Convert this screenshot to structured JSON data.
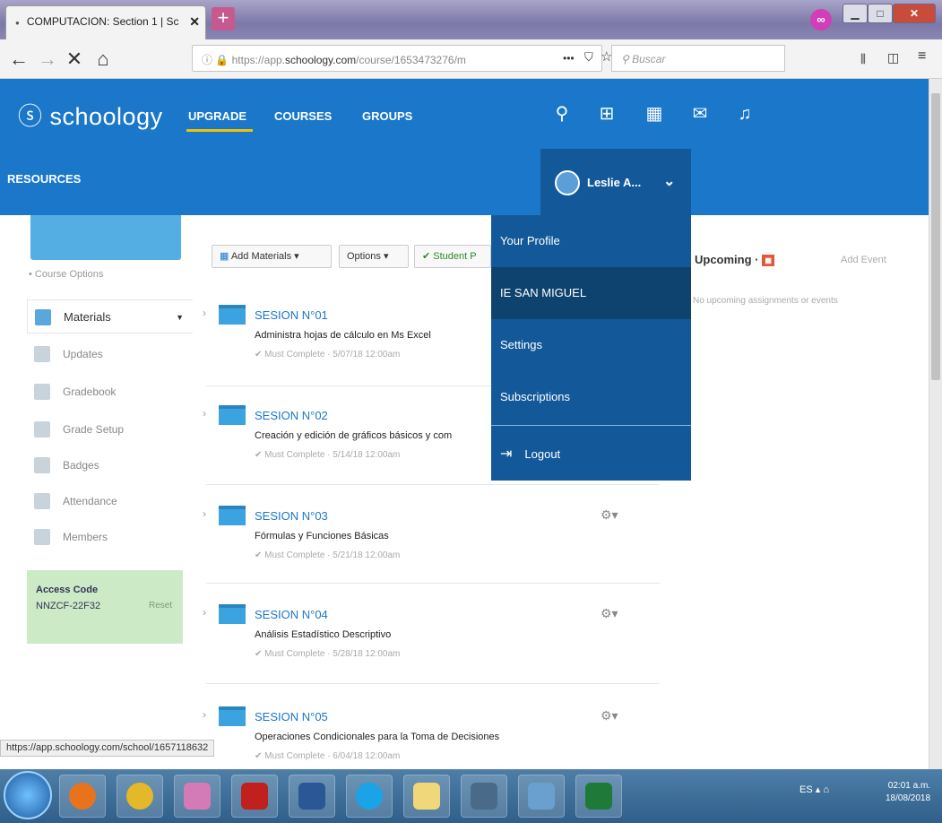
{
  "browser": {
    "tab_title": "COMPUTACION: Section 1 | Sc",
    "new_tab": "+",
    "url_prefix": "https://app.",
    "url_domain": "schoology.com",
    "url_rest": "/course/1653473276/m",
    "url_more": "•••",
    "search_placeholder": "Buscar"
  },
  "app": {
    "logo": "ⓢ schoology",
    "nav": [
      "UPGRADE",
      "COURSES",
      "GROUPS"
    ],
    "resources": "RESOURCES",
    "user_name": "Leslie A..."
  },
  "user_menu": {
    "items": [
      "Your Profile",
      "IE SAN MIGUEL",
      "Settings",
      "Subscriptions",
      "Logout"
    ]
  },
  "sidebar": {
    "course_options": "Course Options",
    "items": [
      "Materials",
      "Updates",
      "Gradebook",
      "Grade Setup",
      "Badges",
      "Attendance",
      "Members"
    ],
    "access_code_label": "Access Code",
    "access_code": "NNZCF-22F32",
    "reset": "Reset"
  },
  "toolbar": {
    "add_materials": "Add Materials ▾",
    "options": "Options ▾",
    "student": "✔ Student P"
  },
  "materials": [
    {
      "title": "SESION N°01",
      "desc": "Administra hojas de cálculo en Ms Excel",
      "meta": "✔ Must Complete · 5/07/18 12:00am"
    },
    {
      "title": "SESION N°02",
      "desc": "Creación y edición de gráficos básicos y com",
      "meta": "✔ Must Complete · 5/14/18 12:00am"
    },
    {
      "title": "SESION N°03",
      "desc": "Fórmulas y Funciones Básicas",
      "meta": "✔ Must Complete · 5/21/18 12:00am"
    },
    {
      "title": "SESION N°04",
      "desc": "Análisis Estadístico Descriptivo",
      "meta": "✔ Must Complete · 5/28/18 12:00am"
    },
    {
      "title": "SESION N°05",
      "desc": "Operaciones Condicionales para la Toma de Decisiones",
      "meta": "✔ Must Complete · 6/04/18 12:00am"
    }
  ],
  "upcoming": {
    "title": "Upcoming",
    "add_event": "Add Event",
    "empty": "No upcoming assignments or events"
  },
  "status_url": "https://app.schoology.com/school/1657118632",
  "taskbar": {
    "lang": "ES",
    "time": "02:01 a.m.",
    "date": "18/08/2018"
  },
  "colors": {
    "brand": "#1a77c9",
    "menu": "#13599a",
    "accent": "#f2c200"
  }
}
